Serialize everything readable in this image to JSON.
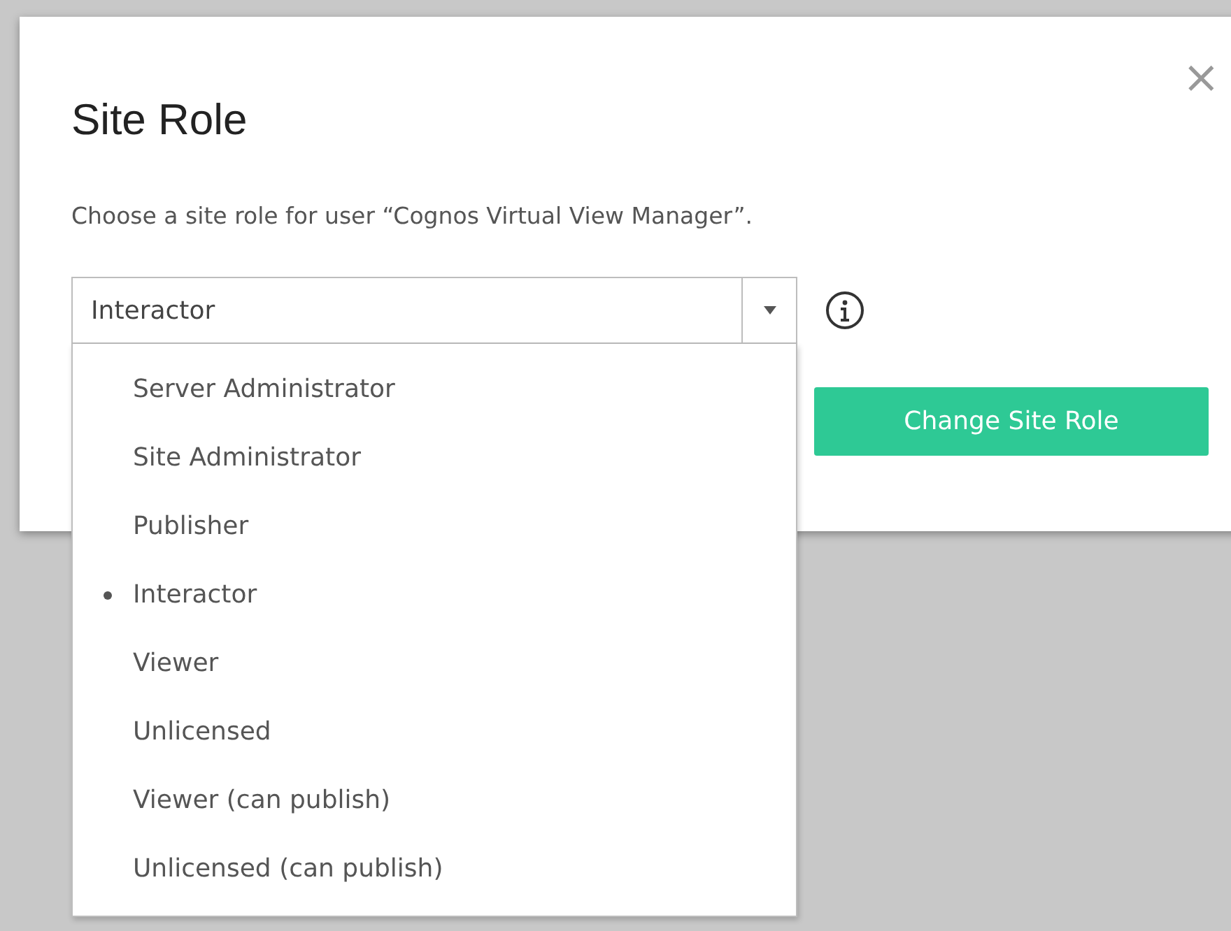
{
  "dialog": {
    "title": "Site Role",
    "close": "×",
    "description": "Choose a site role for user “Cognos Virtual View Manager”.",
    "role_select": {
      "value": "Interactor",
      "expanded": true,
      "options": [
        {
          "label": "Server Administrator",
          "selected": false
        },
        {
          "label": "Site Administrator",
          "selected": false
        },
        {
          "label": "Publisher",
          "selected": false
        },
        {
          "label": "Interactor",
          "selected": true
        },
        {
          "label": "Viewer",
          "selected": false
        },
        {
          "label": "Unlicensed",
          "selected": false
        },
        {
          "label": "Viewer (can publish)",
          "selected": false
        },
        {
          "label": "Unlicensed (can publish)",
          "selected": false
        }
      ]
    },
    "buttons": [
      {
        "label": "Change Site Role"
      }
    ]
  }
}
